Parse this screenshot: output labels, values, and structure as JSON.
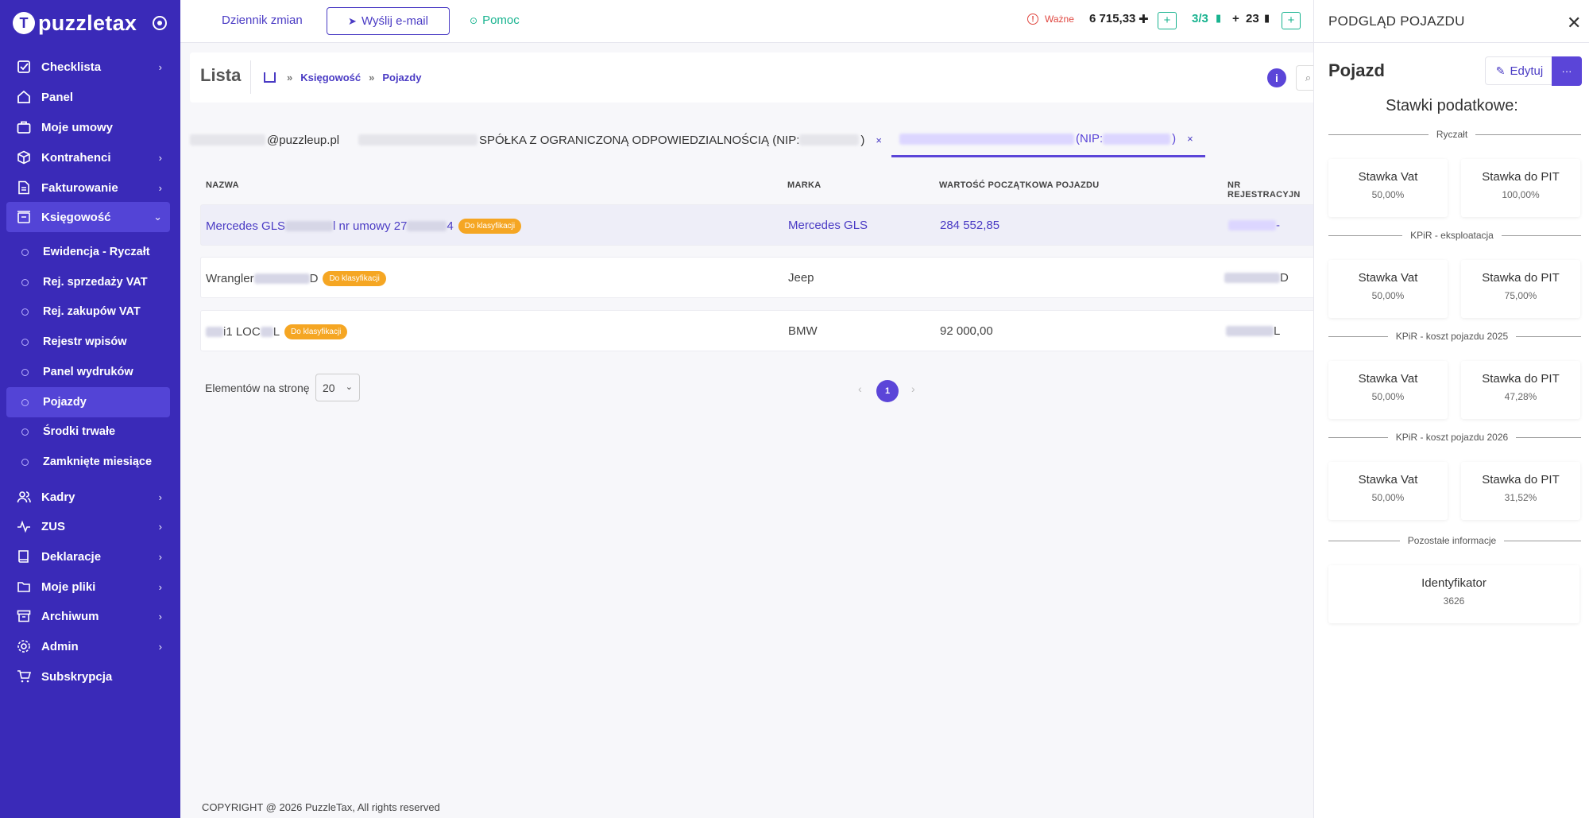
{
  "app": {
    "logo_text": "puzzletax",
    "logo_letter": "T"
  },
  "sidebar": {
    "items": [
      {
        "label": "Checklista",
        "icon": "checklist-icon",
        "chevron": "›"
      },
      {
        "label": "Panel",
        "icon": "home-icon",
        "chevron": ""
      },
      {
        "label": "Moje umowy",
        "icon": "briefcase-icon",
        "chevron": ""
      },
      {
        "label": "Kontrahenci",
        "icon": "box-icon",
        "chevron": "›"
      },
      {
        "label": "Fakturowanie",
        "icon": "document-icon",
        "chevron": "›"
      },
      {
        "label": "Księgowość",
        "icon": "ledger-icon",
        "chevron": "⌄"
      }
    ],
    "subitems": [
      {
        "label": "Ewidencja - Ryczałt"
      },
      {
        "label": "Rej. sprzedaży VAT"
      },
      {
        "label": "Rej. zakupów VAT"
      },
      {
        "label": "Rejestr wpisów"
      },
      {
        "label": "Panel wydruków"
      },
      {
        "label": "Pojazdy"
      },
      {
        "label": "Środki trwałe"
      },
      {
        "label": "Zamknięte miesiące"
      }
    ],
    "bottom_items": [
      {
        "label": "Kadry",
        "icon": "users-icon",
        "chevron": "›"
      },
      {
        "label": "ZUS",
        "icon": "pulse-icon",
        "chevron": "›"
      },
      {
        "label": "Deklaracje",
        "icon": "book-icon",
        "chevron": "›"
      },
      {
        "label": "Moje pliki",
        "icon": "folder-icon",
        "chevron": "›"
      },
      {
        "label": "Archiwum",
        "icon": "archive-icon",
        "chevron": "›"
      },
      {
        "label": "Admin",
        "icon": "gear-icon",
        "chevron": "›"
      },
      {
        "label": "Subskrypcja",
        "icon": "cart-icon",
        "chevron": ""
      }
    ]
  },
  "topbar": {
    "changelog": "Dziennik zmian",
    "send_email": "Wyślij e-mail",
    "help": "Pomoc",
    "important": "Ważne",
    "amount": "6 715,33",
    "ratio": "3/3",
    "plus_sign": "+",
    "docs_count": "23",
    "plus": "+"
  },
  "page": {
    "title": "Lista",
    "breadcrumb": [
      "Księgowość",
      "Pojazdy"
    ],
    "info": "i"
  },
  "tabs": [
    {
      "suffix": "@puzzleup.pl"
    },
    {
      "suffix": "SPÓŁKA Z OGRANICZONĄ ODPOWIEDZIALNOŚCIĄ (NIP: ",
      "end": ")",
      "close": "×"
    },
    {
      "suffix": "(NIP: ",
      "end": ")",
      "close": "×"
    }
  ],
  "table": {
    "headers": [
      "NAZWA",
      "MARKA",
      "WARTOŚĆ POCZĄTKOWA POJAZDU",
      "NR REJESTRACYJN"
    ],
    "rows": [
      {
        "name_a": "Mercedes GLS ",
        "name_b": "l nr umowy 27",
        "name_c": "4",
        "badge": "Do klasyfikacji",
        "brand": "Mercedes GLS",
        "value": "284 552,85",
        "reg": "-"
      },
      {
        "name_a": "Wrangler ",
        "name_b": "D",
        "name_c": "",
        "badge": "Do klasyfikacji",
        "brand": "Jeep",
        "value": "",
        "reg": "D"
      },
      {
        "name_a": "",
        "name_b": "i1 LOC",
        "name_c": "L",
        "badge": "Do klasyfikacji",
        "brand": "BMW",
        "value": "92 000,00",
        "reg": "L"
      }
    ]
  },
  "pagination": {
    "per_page_label": "Elementów na stronę",
    "per_page": "20",
    "prev": "‹",
    "current": "1",
    "next": "›"
  },
  "footer": "COPYRIGHT @ 2026 PuzzleTax, All rights reserved",
  "panel": {
    "title": "PODGLĄD POJAZDU",
    "close": "✕",
    "heading": "Pojazd",
    "edit": "Edytuj",
    "more": "···",
    "subtitle": "Stawki podatkowe:",
    "sections": [
      {
        "label": "Ryczałt",
        "vat_label": "Stawka Vat",
        "vat": "50,00%",
        "pit_label": "Stawka do PIT",
        "pit": "100,00%"
      },
      {
        "label": "KPiR - eksploatacja",
        "vat_label": "Stawka Vat",
        "vat": "50,00%",
        "pit_label": "Stawka do PIT",
        "pit": "75,00%"
      },
      {
        "label": "KPiR - koszt pojazdu 2025",
        "vat_label": "Stawka Vat",
        "vat": "50,00%",
        "pit_label": "Stawka do PIT",
        "pit": "47,28%"
      },
      {
        "label": "KPiR - koszt pojazdu 2026",
        "vat_label": "Stawka Vat",
        "vat": "50,00%",
        "pit_label": "Stawka do PIT",
        "pit": "31,52%"
      }
    ],
    "other_label": "Pozostałe informacje",
    "id_label": "Identyfikator",
    "id_value": "3626"
  },
  "colors": {
    "sidebar": "#3a2ab8",
    "accent": "#5b45d8",
    "badge": "#f5a623",
    "green": "#18b38f",
    "warning": "#e0463f"
  }
}
